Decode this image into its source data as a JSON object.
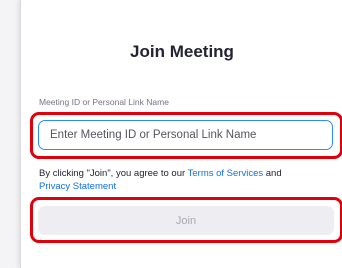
{
  "dialog": {
    "title": "Join Meeting",
    "meeting_id_label": "Meeting ID or Personal Link Name",
    "meeting_id_input": {
      "value": "",
      "placeholder": "Enter Meeting ID or Personal Link Name"
    },
    "agreement": {
      "prefix": "By clicking \"Join\", you agree to our ",
      "terms_link": "Terms of Services",
      "conjunction": " and",
      "privacy_link": "Privacy Statement"
    },
    "join_button": {
      "label": "Join",
      "enabled": false
    }
  },
  "colors": {
    "highlight": "#e0000c",
    "input_focus": "#2d8cff",
    "link": "#0e72ed",
    "disabled_button_bg": "#ededf2"
  }
}
